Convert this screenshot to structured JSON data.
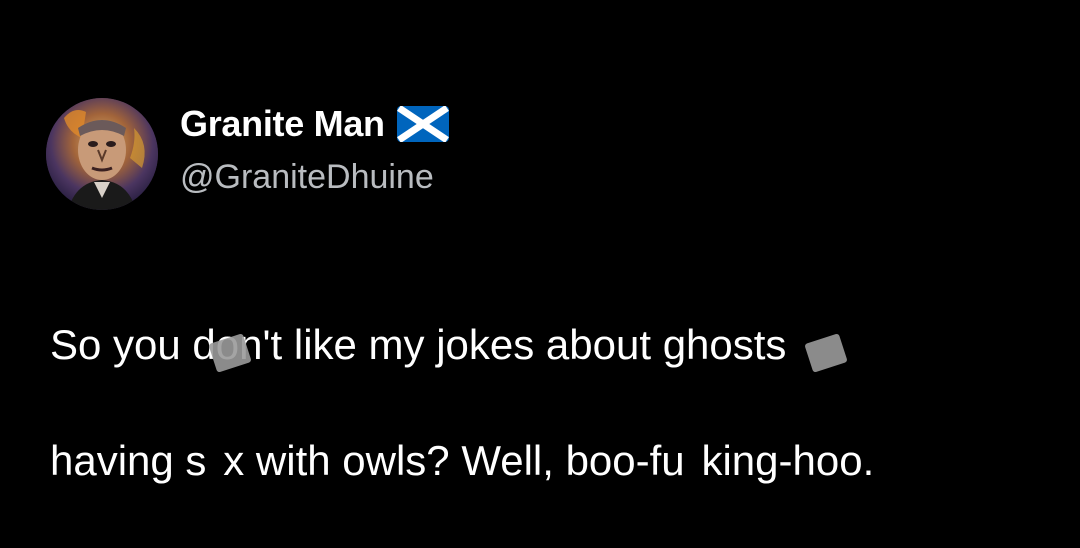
{
  "author": {
    "display_name": "Granite Man",
    "handle": "@GraniteDhuine",
    "badge_icon": "scotland-flag-icon",
    "avatar_icon": "portrait-avatar-icon"
  },
  "tweet": {
    "text_line1": "So you don't like my jokes about ghosts",
    "text_line2": "having s  x with owls? Well, boo-fu  king-hoo."
  },
  "colors": {
    "background": "#000000",
    "name": "#ffffff",
    "handle": "#b9bcc0",
    "body": "#ffffff",
    "flag_blue": "#0065bd",
    "flag_white": "#ffffff",
    "censor_mark": "#9a9a9a"
  }
}
